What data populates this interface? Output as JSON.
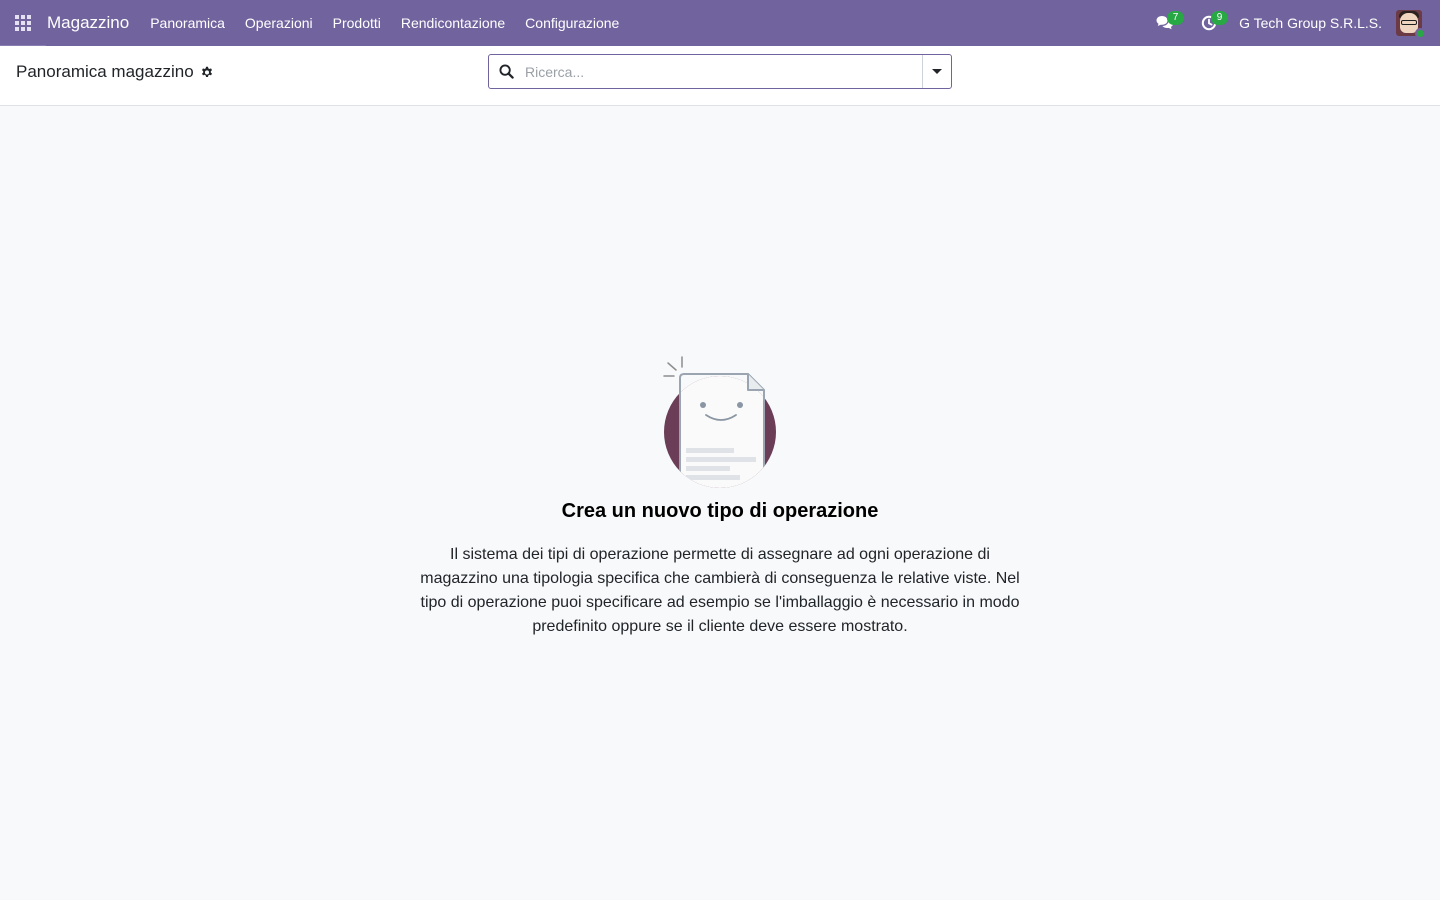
{
  "navbar": {
    "app_name": "Magazzino",
    "menu": [
      {
        "label": "Panoramica"
      },
      {
        "label": "Operazioni"
      },
      {
        "label": "Prodotti"
      },
      {
        "label": "Rendicontazione"
      },
      {
        "label": "Configurazione"
      }
    ],
    "messages_count": "7",
    "activities_count": "9",
    "company": "G Tech Group S.R.L.S.",
    "accent_color": "#71639e",
    "badge_color": "#28a745"
  },
  "control_panel": {
    "breadcrumb": "Panoramica magazzino",
    "search_placeholder": "Ricerca..."
  },
  "empty_state": {
    "title": "Crea un nuovo tipo di operazione",
    "description": "Il sistema dei tipi di operazione permette di assegnare ad ogni operazione di magazzino una tipologia specifica che cambierà di conseguenza le relative viste. Nel tipo di operazione puoi specificare ad esempio se l'imballaggio è necessario in modo predefinito oppure se il cliente deve essere mostrato."
  },
  "icons": {
    "apps": "apps-grid-icon",
    "messages": "comments-icon",
    "activities": "clock-icon",
    "settings": "gear-icon",
    "search": "search-icon",
    "dropdown": "caret-down-icon",
    "illustration": "smiling-document-icon"
  }
}
